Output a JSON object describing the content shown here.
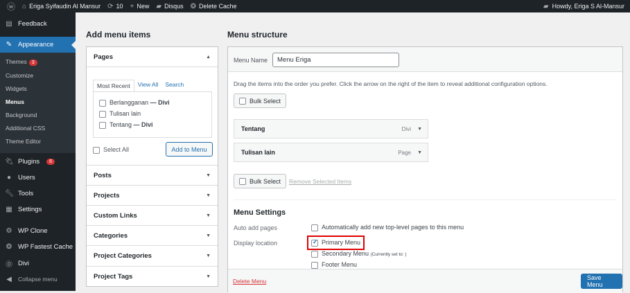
{
  "adminbar": {
    "site": "Eriga Syifaudin Al Mansur",
    "updates": "10",
    "new": "New",
    "disqus": "Disqus",
    "cache": "Delete Cache",
    "howdy": "Howdy, Eriga S Al-Mansur"
  },
  "sidebar": {
    "feedback": "Feedback",
    "appearance": "Appearance",
    "sub": [
      {
        "label": "Themes",
        "badge": "3"
      },
      {
        "label": "Customize"
      },
      {
        "label": "Widgets"
      },
      {
        "label": "Menus"
      },
      {
        "label": "Background"
      },
      {
        "label": "Additional CSS"
      },
      {
        "label": "Theme Editor"
      }
    ],
    "items": [
      {
        "label": "Plugins",
        "badge": "6"
      },
      {
        "label": "Users"
      },
      {
        "label": "Tools"
      },
      {
        "label": "Settings"
      },
      {
        "label": "WP Clone"
      },
      {
        "label": "WP Fastest Cache"
      },
      {
        "label": "Divi"
      },
      {
        "label": "Collapse menu"
      }
    ]
  },
  "add": {
    "title": "Add menu items",
    "pages": "Pages",
    "tabs": [
      "Most Recent",
      "View All",
      "Search"
    ],
    "pages_list": [
      {
        "name": "Berlangganan",
        "suffix": " — Divi"
      },
      {
        "name": "Tulisan lain",
        "suffix": ""
      },
      {
        "name": "Tentang",
        "suffix": " — Divi"
      }
    ],
    "select_all": "Select All",
    "add_button": "Add to Menu",
    "sections": [
      "Posts",
      "Projects",
      "Custom Links",
      "Categories",
      "Project Categories",
      "Project Tags"
    ]
  },
  "structure": {
    "title": "Menu structure",
    "name_label": "Menu Name",
    "name_value": "Menu Eriga",
    "instructions": "Drag the items into the order you prefer. Click the arrow on the right of the item to reveal additional configuration options.",
    "bulk": "Bulk Select",
    "remove": "Remove Selected Items",
    "items": [
      {
        "title": "Tentang",
        "type": "Divi"
      },
      {
        "title": "Tulisan lain",
        "type": "Page"
      }
    ],
    "settings_title": "Menu Settings",
    "auto_label": "Auto add pages",
    "auto_text": "Automatically add new top-level pages to this menu",
    "display_label": "Display location",
    "locations": [
      {
        "name": "Primary Menu",
        "checked": true,
        "note": ""
      },
      {
        "name": "Secondary Menu",
        "checked": false,
        "note": "(Currently set to: )"
      },
      {
        "name": "Footer Menu",
        "checked": false,
        "note": ""
      }
    ],
    "delete": "Delete Menu",
    "save": "Save Menu"
  },
  "colors": {
    "accent": "#2271b1",
    "highlight": "#e00000",
    "danger": "#d63638"
  }
}
